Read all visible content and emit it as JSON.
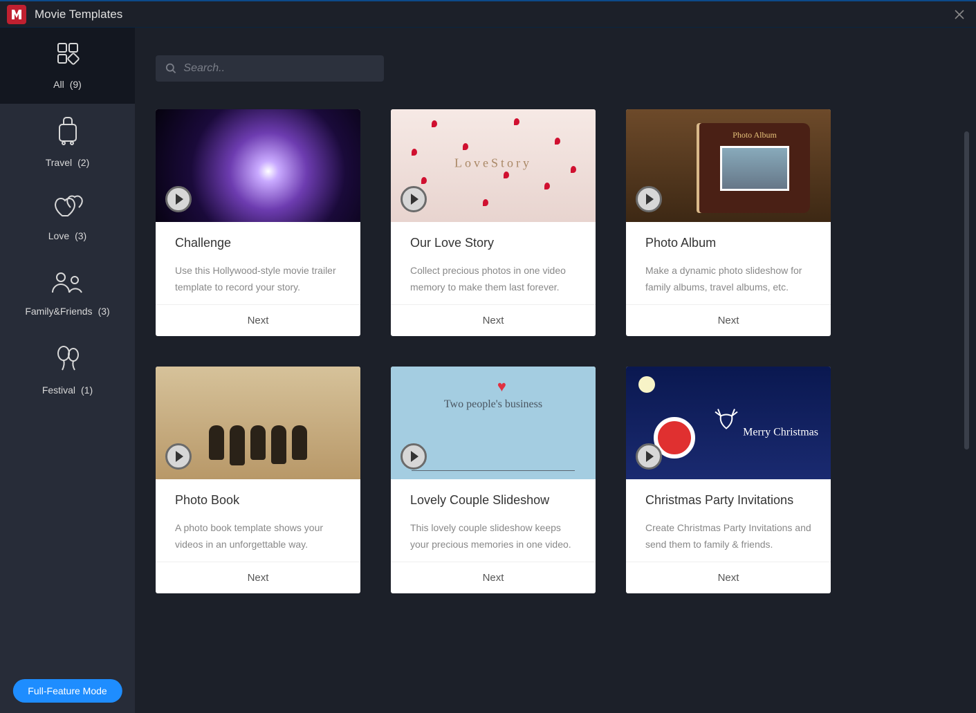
{
  "window": {
    "title": "Movie Templates"
  },
  "sidebar": {
    "items": [
      {
        "label": "All",
        "count": "(9)",
        "icon": "grid"
      },
      {
        "label": "Travel",
        "count": "(2)",
        "icon": "suitcase"
      },
      {
        "label": "Love",
        "count": "(3)",
        "icon": "hearts"
      },
      {
        "label": "Family&Friends",
        "count": "(3)",
        "icon": "people"
      },
      {
        "label": "Festival",
        "count": "(1)",
        "icon": "balloons"
      }
    ],
    "full_feature_label": "Full-Feature Mode"
  },
  "search": {
    "placeholder": "Search.."
  },
  "templates": [
    {
      "title": "Challenge",
      "desc": "Use this Hollywood-style movie trailer template to record your story.",
      "next": "Next",
      "thumb_class": "t-challenge"
    },
    {
      "title": "Our Love Story",
      "desc": "Collect precious photos in one video memory to make them last forever.",
      "next": "Next",
      "thumb_class": "t-love",
      "overlay_text": "LoveStory"
    },
    {
      "title": "Photo Album",
      "desc": "Make a dynamic photo slideshow for family albums, travel albums, etc.",
      "next": "Next",
      "thumb_class": "t-album",
      "overlay_text": "Photo Album"
    },
    {
      "title": "Photo Book",
      "desc": "A photo book template shows your videos in an unforgettable way.",
      "next": "Next",
      "thumb_class": "t-photobook"
    },
    {
      "title": "Lovely Couple Slideshow",
      "desc": "This lovely couple slideshow keeps your precious memories in one video.",
      "next": "Next",
      "thumb_class": "t-couple",
      "overlay_text": "Two people's business"
    },
    {
      "title": "Christmas Party Invitations",
      "desc": "Create Christmas Party Invitations and send them to family & friends.",
      "next": "Next",
      "thumb_class": "t-xmas",
      "overlay_text": "Merry Christmas"
    }
  ]
}
